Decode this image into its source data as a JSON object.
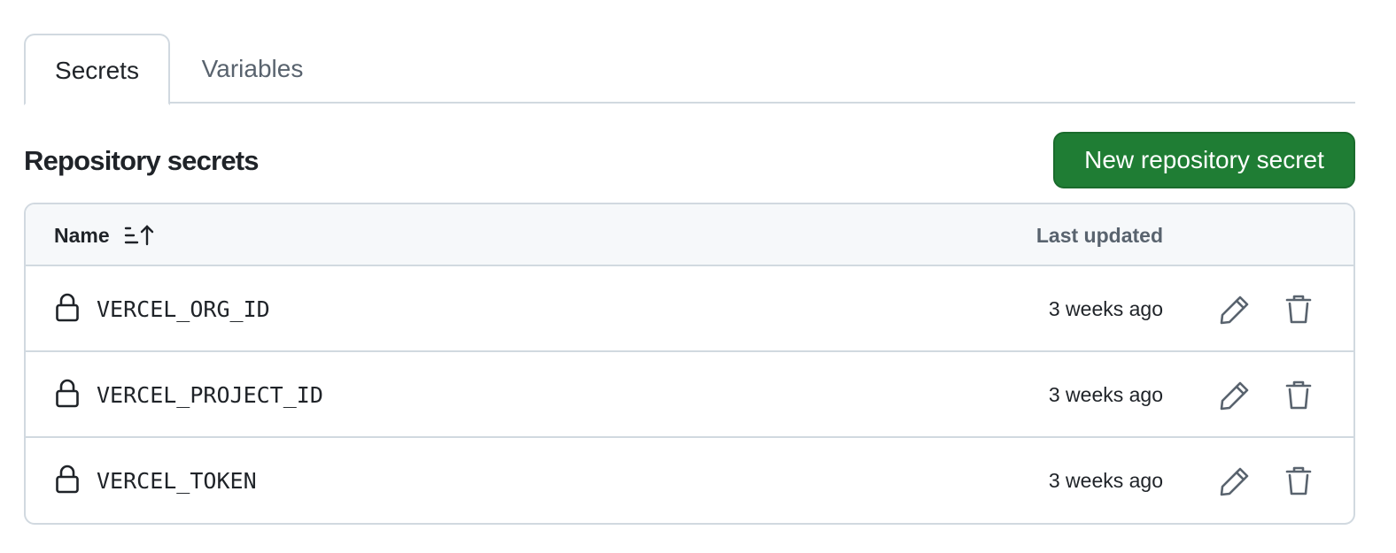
{
  "tabs": [
    {
      "label": "Secrets",
      "active": true
    },
    {
      "label": "Variables",
      "active": false
    }
  ],
  "section": {
    "title": "Repository secrets",
    "new_button_label": "New repository secret"
  },
  "table": {
    "columns": {
      "name": "Name",
      "last_updated": "Last updated"
    },
    "rows": [
      {
        "name": "VERCEL_ORG_ID",
        "updated": "3 weeks ago"
      },
      {
        "name": "VERCEL_PROJECT_ID",
        "updated": "3 weeks ago"
      },
      {
        "name": "VERCEL_TOKEN",
        "updated": "3 weeks ago"
      }
    ]
  },
  "icons": {
    "sort": "sort-ascending-icon",
    "lock": "lock-icon",
    "edit": "pencil-icon",
    "delete": "trash-icon"
  },
  "colors": {
    "primary_button": "#1f7d34",
    "border": "#d1d9e0",
    "header_bg": "#f6f8fa",
    "muted_text": "#59636e"
  }
}
